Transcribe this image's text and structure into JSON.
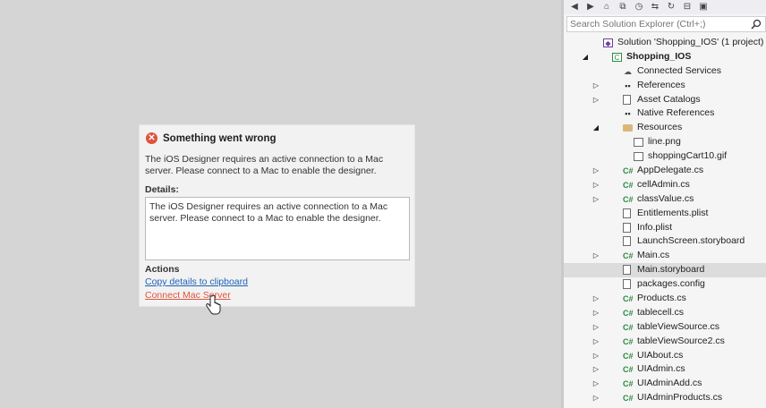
{
  "designer": {
    "error": {
      "title": "Something went wrong",
      "message": "The iOS Designer requires an active connection to a Mac server. Please connect to a Mac to enable the designer.",
      "details_label": "Details:",
      "details_text": "The iOS Designer requires an active connection to a Mac server. Please connect to a Mac to enable the designer.",
      "actions_label": "Actions",
      "copy_link": "Copy details to clipboard",
      "connect_link": "Connect Mac Server"
    }
  },
  "solution_explorer": {
    "search_placeholder": "Search Solution Explorer (Ctrl+;)",
    "toolbar_icons": [
      "back-icon",
      "forward-icon",
      "home-icon",
      "sync-icon",
      "history-icon",
      "pending-changes-icon",
      "refresh-icon",
      "collapse-all-icon",
      "show-all-files-icon"
    ],
    "items": [
      {
        "label": "Solution 'Shopping_IOS' (1 project)",
        "icon": "solution-icon",
        "depth": 0,
        "expander": "none",
        "bold": false,
        "selected": false
      },
      {
        "label": "Shopping_IOS",
        "icon": "csharp-project-icon",
        "depth": 1,
        "expander": "expanded",
        "bold": true,
        "selected": false
      },
      {
        "label": "Connected Services",
        "icon": "connected-services-icon",
        "depth": 2,
        "expander": "none",
        "bold": false,
        "selected": false
      },
      {
        "label": "References",
        "icon": "references-icon",
        "depth": 2,
        "expander": "collapsed",
        "bold": false,
        "selected": false
      },
      {
        "label": "Asset Catalogs",
        "icon": "asset-catalog-icon",
        "depth": 2,
        "expander": "collapsed",
        "bold": false,
        "selected": false
      },
      {
        "label": "Native References",
        "icon": "references-icon",
        "depth": 2,
        "expander": "none",
        "bold": false,
        "selected": false
      },
      {
        "label": "Resources",
        "icon": "folder-icon",
        "depth": 2,
        "expander": "expanded",
        "bold": false,
        "selected": false
      },
      {
        "label": "line.png",
        "icon": "image-file-icon",
        "depth": 3,
        "expander": "none",
        "bold": false,
        "selected": false
      },
      {
        "label": "shoppingCart10.gif",
        "icon": "image-file-icon",
        "depth": 3,
        "expander": "none",
        "bold": false,
        "selected": false
      },
      {
        "label": "AppDelegate.cs",
        "icon": "csharp-file-icon",
        "depth": 2,
        "expander": "collapsed",
        "bold": false,
        "selected": false
      },
      {
        "label": "cellAdmin.cs",
        "icon": "csharp-file-icon",
        "depth": 2,
        "expander": "collapsed",
        "bold": false,
        "selected": false
      },
      {
        "label": "classValue.cs",
        "icon": "csharp-file-icon",
        "depth": 2,
        "expander": "collapsed",
        "bold": false,
        "selected": false
      },
      {
        "label": "Entitlements.plist",
        "icon": "file-icon",
        "depth": 2,
        "expander": "none",
        "bold": false,
        "selected": false
      },
      {
        "label": "Info.plist",
        "icon": "file-icon",
        "depth": 2,
        "expander": "none",
        "bold": false,
        "selected": false
      },
      {
        "label": "LaunchScreen.storyboard",
        "icon": "file-icon",
        "depth": 2,
        "expander": "none",
        "bold": false,
        "selected": false
      },
      {
        "label": "Main.cs",
        "icon": "csharp-file-icon",
        "depth": 2,
        "expander": "collapsed",
        "bold": false,
        "selected": false
      },
      {
        "label": "Main.storyboard",
        "icon": "file-icon",
        "depth": 2,
        "expander": "none",
        "bold": false,
        "selected": true
      },
      {
        "label": "packages.config",
        "icon": "config-file-icon",
        "depth": 2,
        "expander": "none",
        "bold": false,
        "selected": false
      },
      {
        "label": "Products.cs",
        "icon": "csharp-file-icon",
        "depth": 2,
        "expander": "collapsed",
        "bold": false,
        "selected": false
      },
      {
        "label": "tablecell.cs",
        "icon": "csharp-file-icon",
        "depth": 2,
        "expander": "collapsed",
        "bold": false,
        "selected": false
      },
      {
        "label": "tableViewSource.cs",
        "icon": "csharp-file-icon",
        "depth": 2,
        "expander": "collapsed",
        "bold": false,
        "selected": false
      },
      {
        "label": "tableViewSource2.cs",
        "icon": "csharp-file-icon",
        "depth": 2,
        "expander": "collapsed",
        "bold": false,
        "selected": false
      },
      {
        "label": "UIAbout.cs",
        "icon": "csharp-file-icon",
        "depth": 2,
        "expander": "collapsed",
        "bold": false,
        "selected": false
      },
      {
        "label": "UIAdmin.cs",
        "icon": "csharp-file-icon",
        "depth": 2,
        "expander": "collapsed",
        "bold": false,
        "selected": false
      },
      {
        "label": "UIAdminAdd.cs",
        "icon": "csharp-file-icon",
        "depth": 2,
        "expander": "collapsed",
        "bold": false,
        "selected": false
      },
      {
        "label": "UIAdminProducts.cs",
        "icon": "csharp-file-icon",
        "depth": 2,
        "expander": "collapsed",
        "bold": false,
        "selected": false
      }
    ]
  },
  "colors": {
    "error_red": "#e0533d",
    "link_blue": "#1f62b8",
    "selection": "#dcdcdc",
    "csharp_green": "#2b8a3e"
  }
}
